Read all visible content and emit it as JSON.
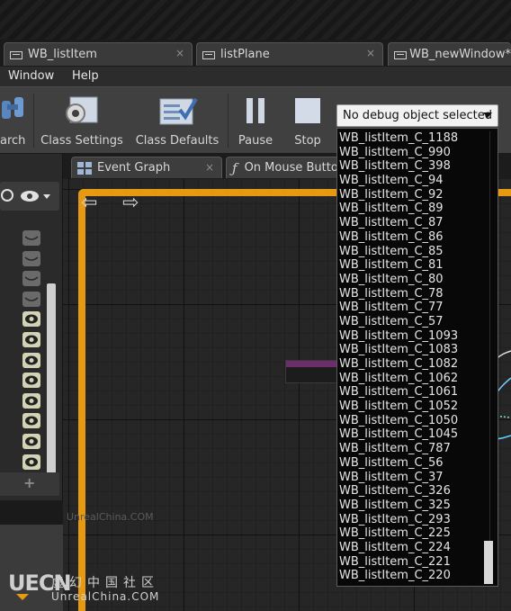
{
  "tabs": [
    {
      "label": "WB_listItem",
      "close": "×"
    },
    {
      "label": "listPlane",
      "close": "×"
    },
    {
      "label": "WB_newWindow*",
      "close": "×"
    }
  ],
  "menu": [
    "Window",
    "Help"
  ],
  "toolbar": {
    "search_partial": "arch",
    "class_settings": "Class Settings",
    "class_defaults": "Class Defaults",
    "pause": "Pause",
    "stop": "Stop"
  },
  "debug_selector": {
    "selected": "No debug object selected",
    "options": [
      "WB_listItem_C_1188",
      "WB_listItem_C_990",
      "WB_listItem_C_398",
      "WB_listItem_C_94",
      "WB_listItem_C_92",
      "WB_listItem_C_89",
      "WB_listItem_C_87",
      "WB_listItem_C_86",
      "WB_listItem_C_85",
      "WB_listItem_C_81",
      "WB_listItem_C_80",
      "WB_listItem_C_78",
      "WB_listItem_C_77",
      "WB_listItem_C_57",
      "WB_listItem_C_1093",
      "WB_listItem_C_1083",
      "WB_listItem_C_1082",
      "WB_listItem_C_1062",
      "WB_listItem_C_1061",
      "WB_listItem_C_1052",
      "WB_listItem_C_1050",
      "WB_listItem_C_1045",
      "WB_listItem_C_787",
      "WB_listItem_C_56",
      "WB_listItem_C_37",
      "WB_listItem_C_326",
      "WB_listItem_C_325",
      "WB_listItem_C_293",
      "WB_listItem_C_225",
      "WB_listItem_C_224",
      "WB_listItem_C_221",
      "WB_listItem_C_220"
    ]
  },
  "doc_tabs": [
    {
      "label": "Event Graph",
      "close": "×"
    },
    {
      "label": "On Mouse Butto"
    }
  ],
  "left_panel": {
    "add_symbol": "+",
    "visibility_rows": [
      "off",
      "off",
      "off",
      "off",
      "on",
      "on",
      "on",
      "on",
      "on",
      "on",
      "on",
      "on"
    ]
  },
  "watermark": {
    "logo": "UECN",
    "chinese": "虚幻中国社区",
    "site": "UnrealChina.COM",
    "faint": "UnrealChina.COM"
  },
  "colors": {
    "accent_orange": "#e69a11",
    "node_header": "#6b2e6b",
    "dropdown_bg": "#080808"
  }
}
